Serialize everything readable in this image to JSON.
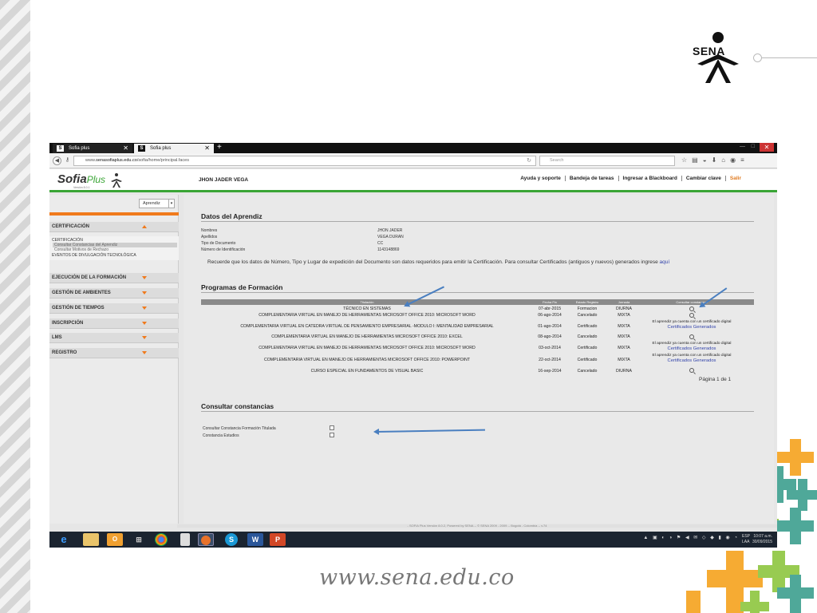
{
  "slide": {
    "brand_logo_text": "SENA",
    "website": "www.sena.edu.co",
    "colors": {
      "stripe": "#d6d6d6",
      "accent_green": "#3aa535",
      "accent_orange": "#f07a1c",
      "cross_green": "#3c9f8f",
      "cross_orange": "#f6a21e",
      "cross_lime": "#8dc63f"
    }
  },
  "browser": {
    "tabs": [
      {
        "label": "Sofia plus",
        "favicon": "S"
      },
      {
        "label": "Sofia plus",
        "favicon": "S"
      }
    ],
    "new_tab_label": "+",
    "url_prefix": "www.",
    "url_domain": "senasofiaplus.edu.co",
    "url_path": "/sofia/home/principal.faces",
    "search_placeholder": "Search",
    "close_label": "✕"
  },
  "app": {
    "logo_main": "Sofia",
    "logo_plus": "Plus",
    "logo_sub": "Versión 8.0.1",
    "user_name": "JHON JADER VEGA",
    "top_menu": [
      "Ayuda y soporte",
      "Bandeja de tareas",
      "Ingresar a Blackboard",
      "Cambiar clave",
      "Salir"
    ],
    "footer": "- SOFIA Plus Versión 8.0.2, Powered by SENA -- © SENA 2009 - 2009 -- Bogotá - Colombia -- v.74"
  },
  "sidebar": {
    "role": "Aprendiz",
    "sections": [
      {
        "label": "CERTIFICACIÓN",
        "expanded": true
      },
      {
        "label": "EJECUCIÓN DE LA FORMACIÓN",
        "expanded": false
      },
      {
        "label": "GESTIÓN DE AMBIENTES",
        "expanded": false
      },
      {
        "label": "GESTIÓN DE TIEMPOS",
        "expanded": false
      },
      {
        "label": "INSCRIPCIÓN",
        "expanded": false
      },
      {
        "label": "LMS",
        "expanded": false
      },
      {
        "label": "REGISTRO",
        "expanded": false
      }
    ],
    "submenu": {
      "group": "CERTIFICACIÓN",
      "items": [
        "Consultar Constancias del Aprendiz",
        "Consultar Motivos de Rechazo"
      ],
      "extra": "EVENTOS DE DIVULGACIÓN TECNOLÓGICA"
    }
  },
  "main": {
    "datos_title": "Datos del Aprendiz",
    "fields": [
      {
        "label": "Nombres",
        "value": "JHON JADER"
      },
      {
        "label": "Apellidos",
        "value": "VEGA DURAN"
      },
      {
        "label": "Tipo de Documento",
        "value": "CC"
      },
      {
        "label": "Número de Identificación",
        "value": "1143148869"
      }
    ],
    "notice": "Recuerde que los datos de Número, Tipo y Lugar de expedición del Documento son datos requeridos para emitir la Certificación. Para consultar Certificados (antiguos y nuevos) generados ingrese",
    "notice_link": "aquí",
    "programas_title": "Programas de Formación",
    "table_headers": [
      "Titulación",
      "Fecha Fin",
      "Estado Registro",
      "Jornada",
      "Consultar constancias"
    ],
    "rows": [
      {
        "titulacion": "TÉCNICO EN SISTEMAS",
        "fecha": "07-abr-2015",
        "estado": "Formacion",
        "jornada": "DIURNA",
        "consulta": "icon"
      },
      {
        "titulacion": "COMPLEMENTARIA VIRTUAL EN MANEJO DE HERRAMIENTAS MICROSOFT OFFICE 2010: MICROSOFT WORD",
        "fecha": "06-ago-2014",
        "estado": "Cancelado",
        "jornada": "MIXTA",
        "consulta": "icon"
      },
      {
        "titulacion": "COMPLEMENTARIA VIRTUAL EN CATEDRA VIRTUAL DE PENSAMIENTO EMPRESARIAL -MODULO I: MENTALIDAD EMPRESARIAL",
        "fecha": "01-ago-2014",
        "estado": "Certificado",
        "jornada": "MIXTA",
        "consulta": "note"
      },
      {
        "titulacion": "COMPLEMENTARIA VIRTUAL EN MANEJO DE HERRAMIENTAS MICROSOFT OFFICE 2010: EXCEL",
        "fecha": "08-ago-2014",
        "estado": "Cancelado",
        "jornada": "MIXTA",
        "consulta": "icon"
      },
      {
        "titulacion": "COMPLEMENTARIA VIRTUAL EN MANEJO DE HERRAMIENTAS MICROSOFT OFFICE 2010: MICROSOFT WORD",
        "fecha": "03-oct-2014",
        "estado": "Certificado",
        "jornada": "MIXTA",
        "consulta": "note"
      },
      {
        "titulacion": "COMPLEMENTARIA VIRTUAL EN MANEJO DE HERRAMIENTAS MICROSOFT OFFICE 2010: POWERPOINT",
        "fecha": "22-oct-2014",
        "estado": "Certificado",
        "jornada": "MIXTA",
        "consulta": "note"
      },
      {
        "titulacion": "CURSO ESPECIAL EN FUNDAMENTOS DE VISUAL BASIC",
        "fecha": "16-sep-2014",
        "estado": "Cancelado",
        "jornada": "DIURNA",
        "consulta": "icon"
      }
    ],
    "cert_note_text": "El aprendiz ya cuenta con un certificado digital",
    "cert_note_link": "Certificados Generados",
    "pagination": "Página 1 de 1",
    "constancias_title": "Consultar constancias",
    "constancias": [
      "Consultar Constancia Formación Titulada",
      "Constancia Estudios"
    ]
  },
  "taskbar": {
    "apps": [
      "internet-explorer-icon",
      "file-explorer-icon",
      "outlook-icon",
      "network-icon",
      "chrome-icon",
      "document-icon",
      "firefox-icon",
      "skype-icon",
      "word-icon",
      "powerpoint-icon"
    ],
    "lang_top": "ESP",
    "lang_bottom": "LAA",
    "time": "10:07 a.m.",
    "date": "30/09/2015"
  }
}
